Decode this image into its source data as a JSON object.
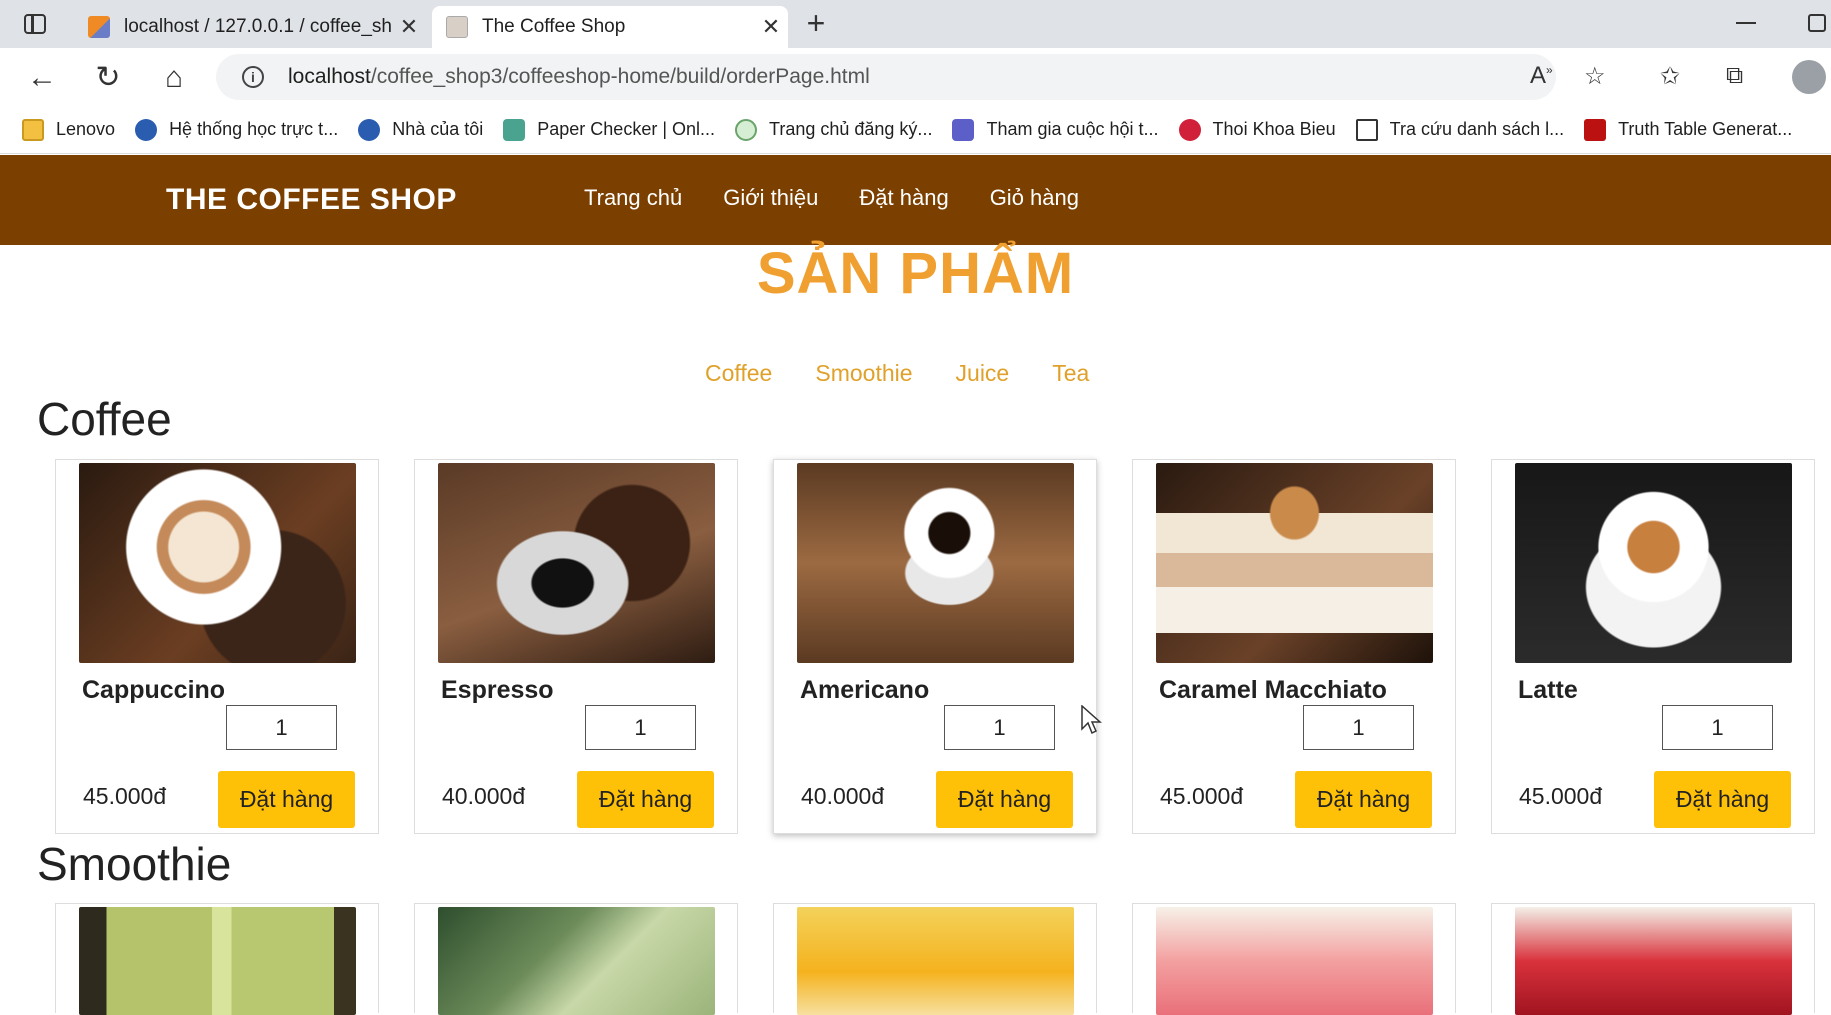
{
  "browser": {
    "tabs": [
      {
        "title": "localhost / 127.0.0.1 / coffee_shc",
        "favicon": "phpmyadmin-icon",
        "active": false
      },
      {
        "title": "The Coffee Shop",
        "favicon": "coffee-shop-favicon",
        "active": true
      }
    ],
    "address": {
      "host": "localhost",
      "path": "/coffee_shop3/coffeeshop-home/build/orderPage.html"
    },
    "bookmarks": [
      {
        "label": "Lenovo",
        "icon": "folder-icon"
      },
      {
        "label": "Hệ thống học trực t...",
        "icon": "globe-icon"
      },
      {
        "label": "Nhà của tôi",
        "icon": "globe-icon"
      },
      {
        "label": "Paper Checker | Onl...",
        "icon": "paper-checker-icon"
      },
      {
        "label": "Trang chủ đăng ký...",
        "icon": "site-icon"
      },
      {
        "label": "Tham gia cuộc hội t...",
        "icon": "teams-icon"
      },
      {
        "label": "Thoi Khoa Bieu",
        "icon": "arc-icon"
      },
      {
        "label": "Tra cứu danh sách l...",
        "icon": "document-icon"
      },
      {
        "label": "Truth Table Generat...",
        "icon": "stanford-icon"
      }
    ]
  },
  "site": {
    "brand": "THE COFFEE SHOP",
    "menu": [
      "Trang chủ",
      "Giới thiệu",
      "Đặt hàng",
      "Giỏ hàng"
    ],
    "section_title": "SẢN PHẨM",
    "categories": [
      "Coffee",
      "Smoothie",
      "Juice",
      "Tea"
    ],
    "accent_color": "#7b3f00",
    "button_color": "#ffc107",
    "groups": [
      {
        "title": "Coffee",
        "products": [
          {
            "name": "Cappuccino",
            "qty": "1",
            "price": "45.000đ",
            "button": "Đặt hàng"
          },
          {
            "name": "Espresso",
            "qty": "1",
            "price": "40.000đ",
            "button": "Đặt hàng"
          },
          {
            "name": "Americano",
            "qty": "1",
            "price": "40.000đ",
            "button": "Đặt hàng"
          },
          {
            "name": "Caramel Macchiato",
            "qty": "1",
            "price": "45.000đ",
            "button": "Đặt hàng"
          },
          {
            "name": "Latte",
            "qty": "1",
            "price": "45.000đ",
            "button": "Đặt hàng"
          }
        ]
      },
      {
        "title": "Smoothie"
      }
    ]
  }
}
